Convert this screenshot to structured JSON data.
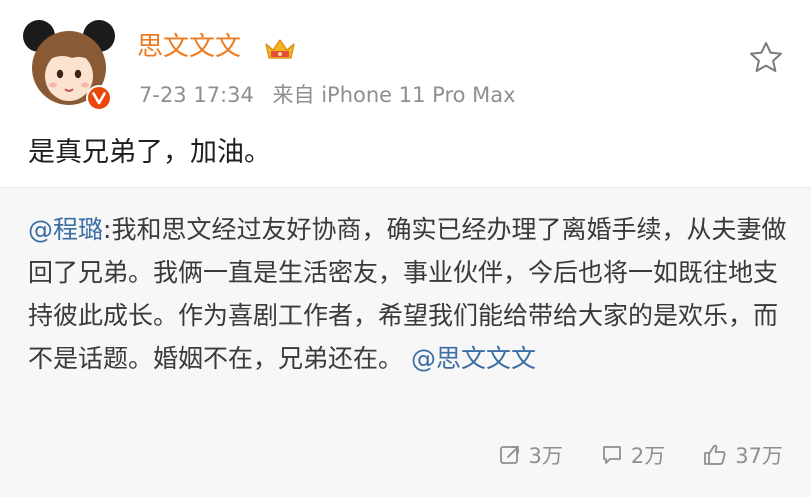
{
  "post": {
    "author": "思文文文",
    "timestamp": "7-23 17:34",
    "source": "来自 iPhone 11 Pro Max",
    "text": "是真兄弟了，加油。",
    "badges": {
      "vip_icon": "crown-icon",
      "verified_icon": "verified-v-icon"
    },
    "favorite_icon": "star-icon"
  },
  "quoted": {
    "mention": "@程璐",
    "separator": ":",
    "body": "我和思文经过友好协商，确实已经办理了离婚手续，从夫妻做回了兄弟。我俩一直是生活密友，事业伙伴，今后也将一如既往地支持彼此成长。作为喜剧工作者，希望我们能给带给大家的是欢乐，而不是话题。婚姻不在，兄弟还在。",
    "trailing_mention": "@思文文文"
  },
  "actions": {
    "repost": {
      "icon": "repost-icon",
      "count": "3万"
    },
    "comment": {
      "icon": "comment-icon",
      "count": "2万"
    },
    "like": {
      "icon": "thumbs-up-icon",
      "count": "37万"
    }
  },
  "colors": {
    "author_name": "#ee7b1f",
    "mention": "#3b6ea5",
    "meta_text": "#8e8e93",
    "quote_background": "#f7f7f7",
    "verified_badge": "#e8480c"
  }
}
